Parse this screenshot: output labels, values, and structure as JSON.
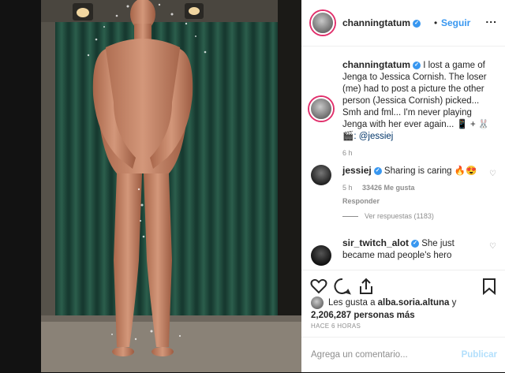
{
  "post": {
    "username": "channingtatum",
    "follow_label": "Seguir",
    "menu_label": "...",
    "caption_username": "channingtatum",
    "caption_text": "I lost a game of Jenga to Jessica Cornish. The loser (me) had to post a picture the other person (Jessica Cornish) picked... Smh and fml... I'm never playing Jenga with her ever again...",
    "caption_tail": " + ",
    "caption_mention": ": @jessiej",
    "caption_time": "6 h"
  },
  "comments": [
    {
      "username": "jessiej",
      "text": "Sharing is caring ",
      "emoji": "🔥😍",
      "time": "5 h",
      "likes": "33426 Me gusta",
      "reply": "Responder",
      "view_replies": "Ver respuestas (1183)"
    },
    {
      "username": "sir_twitch_alot",
      "text": "She just became mad people's hero"
    }
  ],
  "likes": {
    "prefix": "Les gusta a ",
    "user": "alba.soria.altuna",
    "mid": " y",
    "count": "2,206,287 personas más"
  },
  "date": "HACE 6 HORAS",
  "add_comment": {
    "placeholder": "Agrega un comentario...",
    "publish": "Publicar"
  },
  "colors": {
    "accent": "#3897f0",
    "muted": "#8e8e8e",
    "text": "#262626",
    "tile": "#1f4a3c"
  },
  "icons": [
    "heart-icon",
    "comment-icon",
    "share-icon",
    "bookmark-icon",
    "verified-icon",
    "more-icon"
  ]
}
